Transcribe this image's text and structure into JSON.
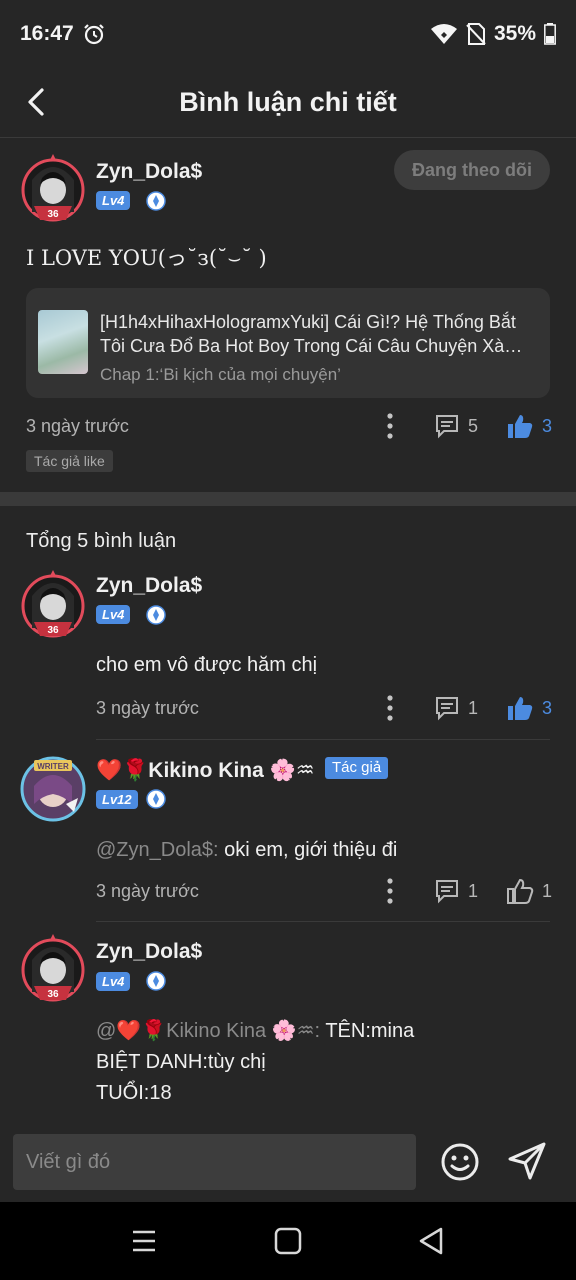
{
  "status_bar": {
    "time": "16:47",
    "battery": "35%"
  },
  "header": {
    "title": "Bình luận chi tiết"
  },
  "post": {
    "username": "Zyn_Dola$",
    "level": "Lv4",
    "follow_label": "Đang theo dõi",
    "text": "I LOVE YOU(っ˘з(˘⌣˘ )",
    "story": {
      "title": "[H1h4xHihaxHologramxYuki] Cái Gì!? Hệ Thống Bắt Tôi Cưa Đổ Ba Hot Boy Trong Cái Câu Chuyện Xà…",
      "chapter": "Chap 1:‘Bi kịch của mọi chuyện’"
    },
    "time": "3 ngày trước",
    "reply_count": "5",
    "like_count": "3",
    "tag": "Tác giả like"
  },
  "comments_total": "Tổng 5 bình luận",
  "comments": [
    {
      "username": "Zyn_Dola$",
      "level": "Lv4",
      "text": "cho em vô được hăm chị⁠",
      "time": "3 ngày trước",
      "reply_count": "1",
      "like_count": "3"
    },
    {
      "username": "❤️🌹Kikino Kina 🌸♒",
      "level": "Lv12",
      "author_badge": "Tác giả",
      "mention": "@Zyn_Dola$:",
      "text": " oki em, giới thiệu đi",
      "time": "3 ngày trước",
      "reply_count": "1",
      "like_count": "1"
    },
    {
      "username": "Zyn_Dola$",
      "level": "Lv4",
      "mention": "@❤️🌹Kikino Kina 🌸♒:",
      "line1": " TÊN:mina",
      "line2": "BIỆT DANH:tùy chị",
      "line3": "TUỔI:18"
    }
  ],
  "input": {
    "placeholder": "Viết gì đó"
  },
  "colors": {
    "accent": "#4c8be0",
    "background": "#262626",
    "card": "#333333"
  }
}
